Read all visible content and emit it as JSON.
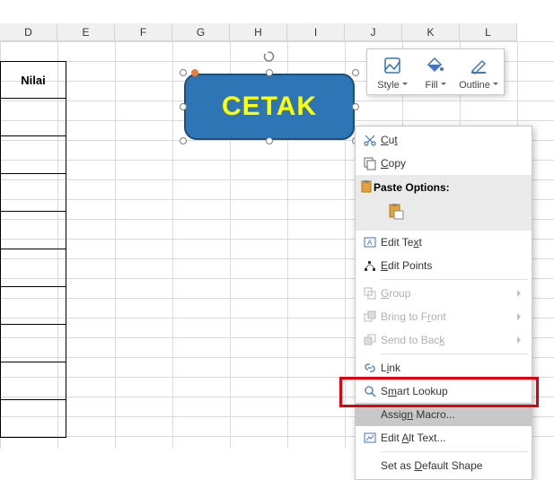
{
  "columns": [
    "D",
    "E",
    "F",
    "G",
    "H",
    "I",
    "J",
    "K",
    "L"
  ],
  "nilai_header": "Nilai",
  "shape": {
    "text": "CETAK"
  },
  "toolbar": {
    "style": "Style",
    "fill": "Fill",
    "outline": "Outline"
  },
  "menu": {
    "cut": "Cut",
    "copy": "Copy",
    "paste_options": "Paste Options:",
    "edit_text": "Edit Text",
    "edit_points": "Edit Points",
    "group": "Group",
    "bring_front": "Bring to Front",
    "send_back": "Send to Back",
    "link": "Link",
    "smart_lookup": "Smart Lookup",
    "assign_macro": "Assign Macro...",
    "edit_alt_text": "Edit Alt Text...",
    "default_shape": "Set as Default Shape"
  }
}
